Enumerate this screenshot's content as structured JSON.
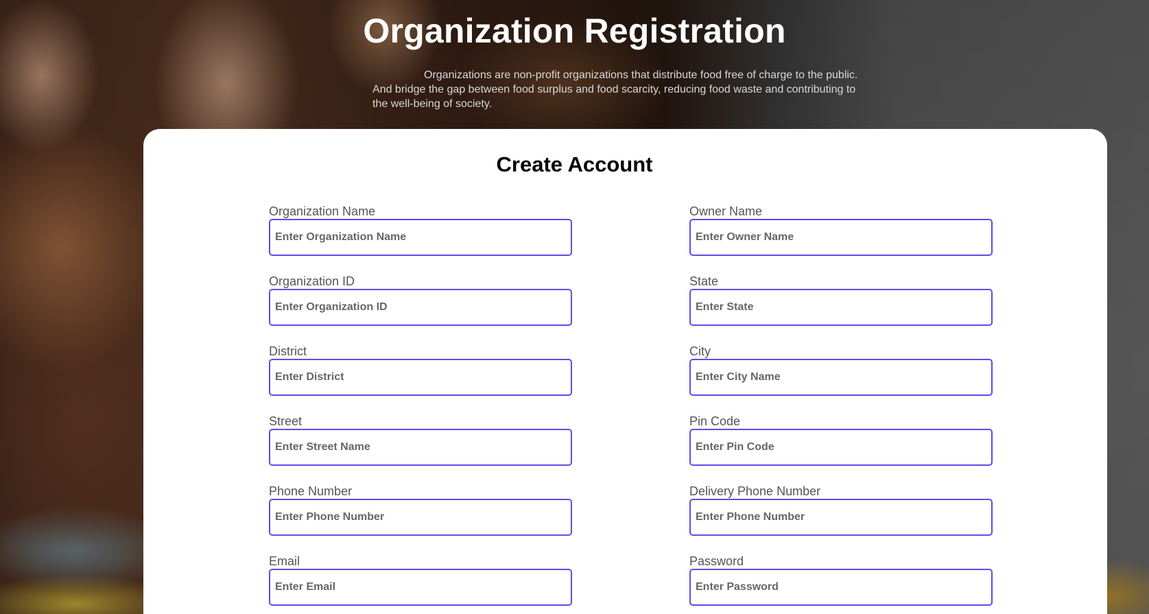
{
  "hero": {
    "title": "Organization Registration",
    "description": "Organizations are non-profit organizations that distribute food free of charge to the public. And bridge the gap between food surplus and food scarcity, reducing food waste and contributing to the well-being of society."
  },
  "form": {
    "title": "Create Account",
    "fields": {
      "org_name": {
        "label": "Organization Name",
        "placeholder": "Enter Organization Name"
      },
      "owner_name": {
        "label": "Owner Name",
        "placeholder": "Enter Owner Name"
      },
      "org_id": {
        "label": "Organization ID",
        "placeholder": "Enter Organization ID"
      },
      "state": {
        "label": "State",
        "placeholder": "Enter State"
      },
      "district": {
        "label": "District",
        "placeholder": "Enter District"
      },
      "city": {
        "label": "City",
        "placeholder": "Enter City Name"
      },
      "street": {
        "label": "Street",
        "placeholder": "Enter Street Name"
      },
      "pin_code": {
        "label": "Pin Code",
        "placeholder": "Enter Pin Code"
      },
      "phone": {
        "label": "Phone Number",
        "placeholder": "Enter Phone Number"
      },
      "delivery_phone": {
        "label": "Delivery Phone Number",
        "placeholder": "Enter Phone Number"
      },
      "email": {
        "label": "Email",
        "placeholder": "Enter Email"
      },
      "password": {
        "label": "Password",
        "placeholder": "Enter Password"
      }
    }
  },
  "colors": {
    "input_border": "#5b4ee8",
    "card_background": "#ffffff"
  }
}
